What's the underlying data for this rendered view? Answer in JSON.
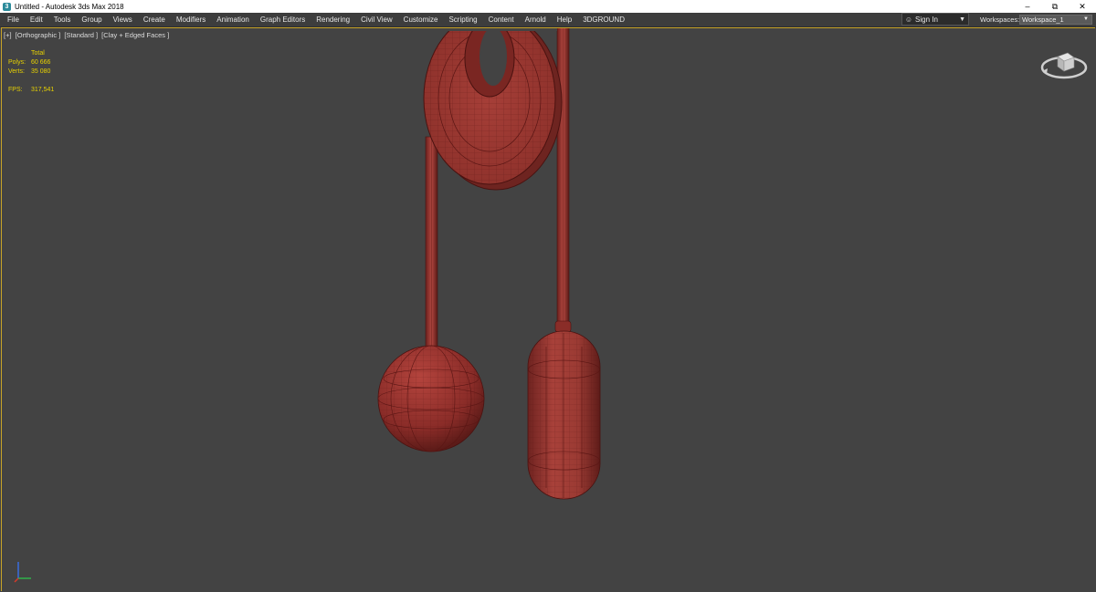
{
  "titlebar": {
    "title": "Untitled - Autodesk 3ds Max 2018",
    "controls": [
      "minimize-icon",
      "restore-icon",
      "close-icon"
    ]
  },
  "menubar": {
    "items": [
      "File",
      "Edit",
      "Tools",
      "Group",
      "Views",
      "Create",
      "Modifiers",
      "Animation",
      "Graph Editors",
      "Rendering",
      "Civil View",
      "Customize",
      "Scripting",
      "Content",
      "Arnold",
      "Help",
      "3DGROUND"
    ],
    "signin": "Sign In",
    "workspaces_label": "Workspaces:",
    "workspace_value": "Workspace_1"
  },
  "viewport": {
    "labels": [
      "[+]",
      "[Orthographic ]",
      "[Standard ]",
      "[Clay + Edged Faces ]"
    ],
    "stats": {
      "total_header": "Total",
      "polys_label": "Polys:",
      "polys_value": "60 666",
      "verts_label": "Verts:",
      "verts_value": "35 080",
      "fps_label": "FPS:",
      "fps_value": "317,541"
    },
    "icons": [
      "viewcube-icon",
      "axis-tripod-icon"
    ]
  },
  "colors": {
    "viewport_bg": "#434343",
    "menubar_bg": "#3d3d3d",
    "active_border": "#c8a428",
    "stats_text": "#e8d200",
    "clay": "#9a3530",
    "wire": "#5a1614"
  }
}
